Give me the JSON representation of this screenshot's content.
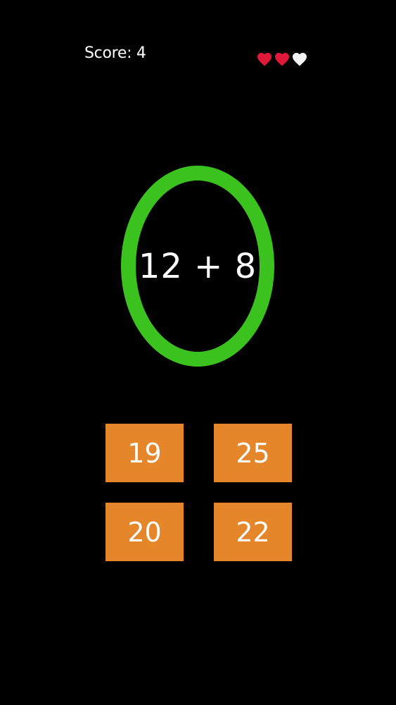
{
  "hud": {
    "score_text": "Score: 4",
    "lives_total": 3,
    "lives_remaining": 2,
    "life_colors": {
      "full": "#e0193a",
      "empty": "#f4f4f4"
    }
  },
  "question": {
    "text": "12 + 8",
    "ring_color": "#3cc21f"
  },
  "answers": {
    "button_color": "#e5862a",
    "options": [
      "19",
      "25",
      "20",
      "22"
    ]
  }
}
